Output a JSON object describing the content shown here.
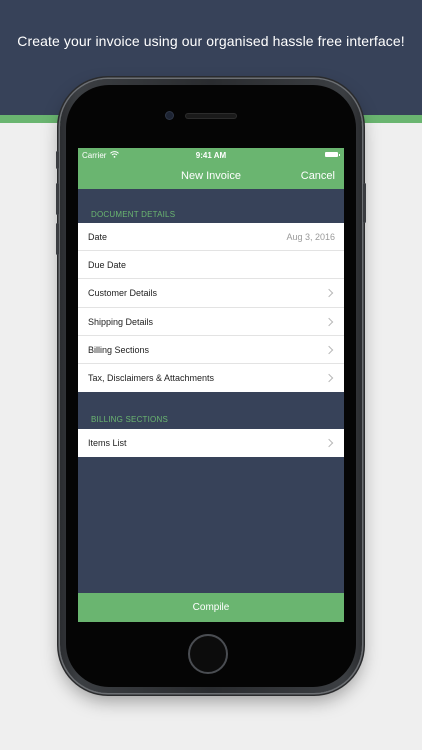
{
  "headline": "Create your invoice using our organised hassle free interface!",
  "status_bar": {
    "carrier": "Carrier",
    "time": "9:41 AM"
  },
  "navbar": {
    "title": "New Invoice",
    "cancel_label": "Cancel"
  },
  "document_details": {
    "header": "DOCUMENT DETAILS",
    "rows": [
      {
        "label": "Date",
        "value": "Aug 3, 2016"
      },
      {
        "label": "Due Date"
      },
      {
        "label": "Customer Details"
      },
      {
        "label": "Shipping Details"
      },
      {
        "label": "Billing Sections"
      },
      {
        "label": "Tax, Disclaimers & Attachments"
      }
    ]
  },
  "billing_sections": {
    "header": "BILLING SECTIONS",
    "rows": [
      {
        "label": "Items List"
      }
    ]
  },
  "compile_label": "Compile",
  "colors": {
    "accent": "#6ab570",
    "navy": "#374259",
    "background": "#efefef"
  }
}
